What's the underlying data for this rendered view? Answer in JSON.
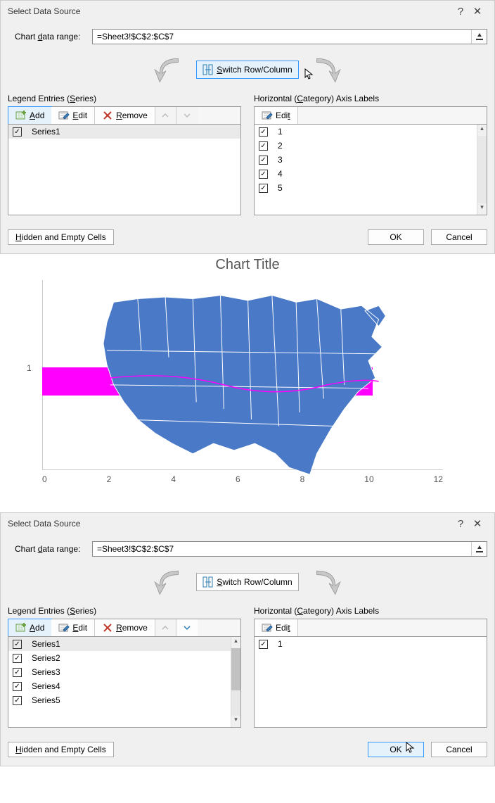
{
  "dialog1": {
    "title": "Select Data Source",
    "help": "?",
    "close": "✕",
    "range_label": "Chart data range:",
    "range_value": "=Sheet3!$C$2:$C$7",
    "switch_label": "Switch Row/Column",
    "legend_header": "Legend Entries (Series)",
    "category_header": "Horizontal (Category) Axis Labels",
    "add_label": "Add",
    "edit_label": "Edit",
    "remove_label": "Remove",
    "cat_edit_label": "Edit",
    "series": [
      "Series1"
    ],
    "categories": [
      "1",
      "2",
      "3",
      "4",
      "5"
    ],
    "hidden_label": "Hidden and Empty Cells",
    "ok_label": "OK",
    "cancel_label": "Cancel"
  },
  "chart_data": {
    "type": "bar",
    "title": "Chart Title",
    "categories": [
      "1"
    ],
    "values": [
      null
    ],
    "x_ticks": [
      "0",
      "2",
      "4",
      "6",
      "8",
      "10",
      "12"
    ],
    "y_ticks": [
      "1"
    ],
    "overlay": "us-map"
  },
  "dialog2": {
    "title": "Select Data Source",
    "help": "?",
    "close": "✕",
    "range_label": "Chart data range:",
    "range_value": "=Sheet3!$C$2:$C$7",
    "switch_label": "Switch Row/Column",
    "legend_header": "Legend Entries (Series)",
    "category_header": "Horizontal (Category) Axis Labels",
    "add_label": "Add",
    "edit_label": "Edit",
    "remove_label": "Remove",
    "cat_edit_label": "Edit",
    "series": [
      "Series1",
      "Series2",
      "Series3",
      "Series4",
      "Series5"
    ],
    "categories": [
      "1"
    ],
    "hidden_label": "Hidden and Empty Cells",
    "ok_label": "OK",
    "cancel_label": "Cancel"
  }
}
